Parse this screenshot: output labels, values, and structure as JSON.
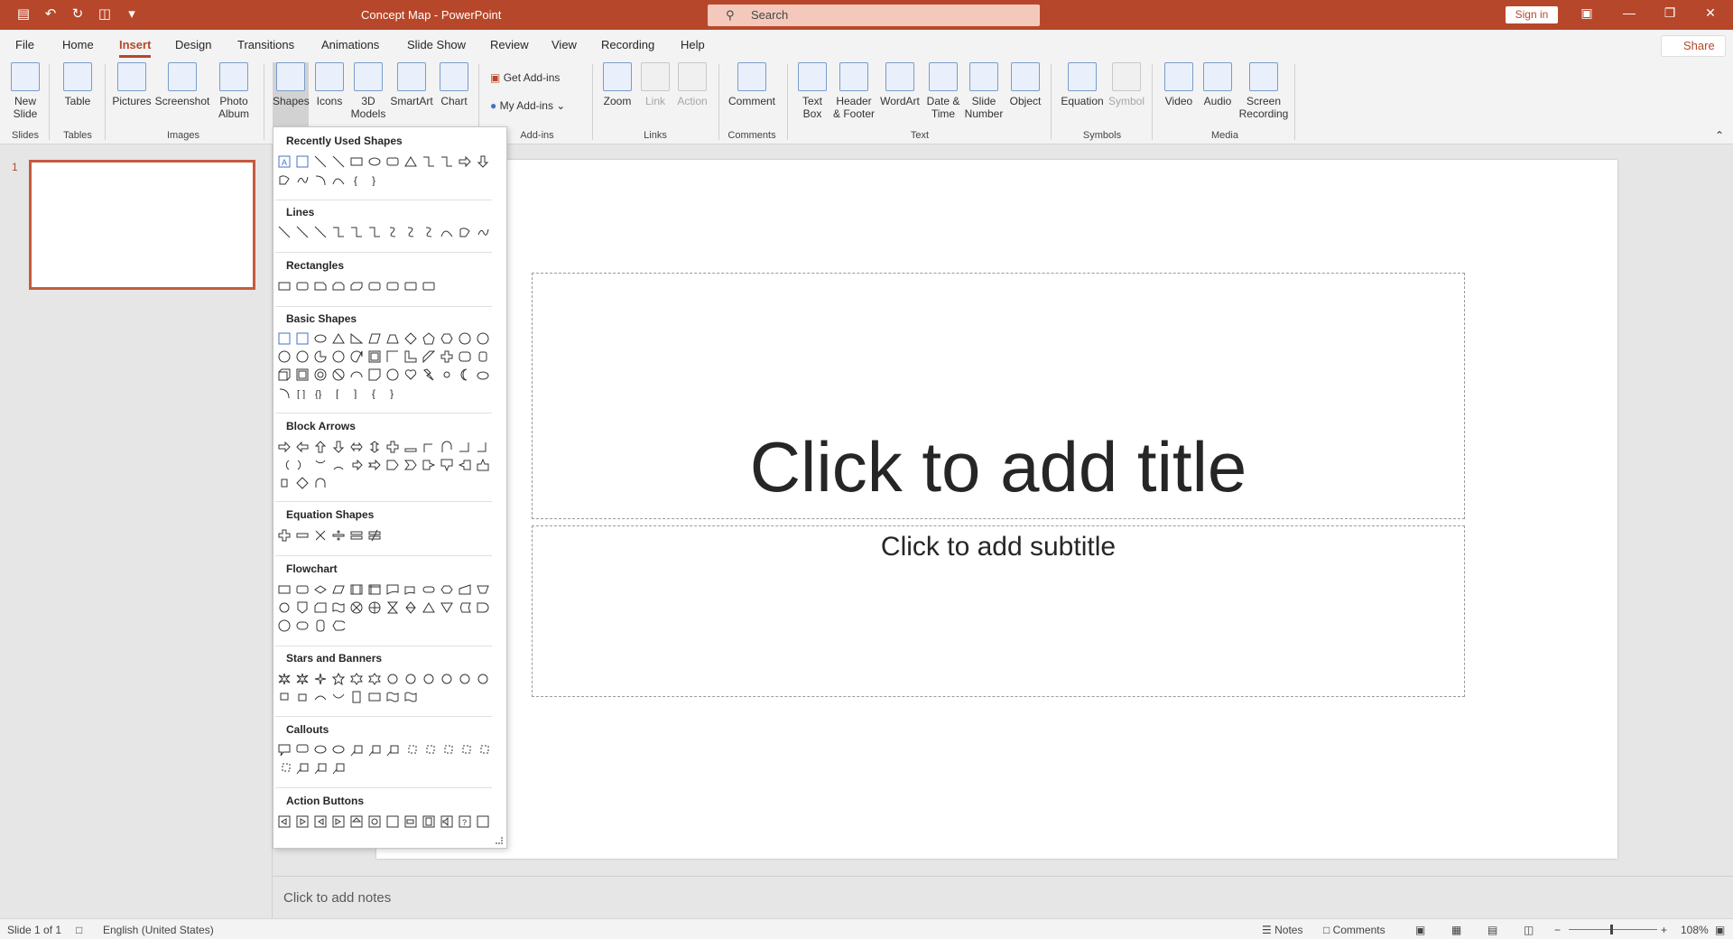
{
  "titlebar": {
    "doc_title": "Concept Map  -  PowerPoint",
    "search_placeholder": "Search",
    "signin_label": "Sign in"
  },
  "tabs": [
    "File",
    "Home",
    "Insert",
    "Design",
    "Transitions",
    "Animations",
    "Slide Show",
    "Review",
    "View",
    "Recording",
    "Help"
  ],
  "share_label": "Share",
  "ribbon": {
    "new_slide": "New\nSlide",
    "table": "Table",
    "pictures": "Pictures",
    "screenshot": "Screenshot",
    "photo_album": "Photo\nAlbum",
    "shapes": "Shapes",
    "icons": "Icons",
    "models": "3D\nModels",
    "smartart": "SmartArt",
    "chart": "Chart",
    "get_addins": "Get Add-ins",
    "my_addins": "My Add-ins",
    "zoom": "Zoom",
    "link": "Link",
    "action": "Action",
    "comment": "Comment",
    "text_box": "Text\nBox",
    "header_footer": "Header\n& Footer",
    "wordart": "WordArt",
    "date_time": "Date &\nTime",
    "slide_number": "Slide\nNumber",
    "object": "Object",
    "equation": "Equation",
    "symbol": "Symbol",
    "video": "Video",
    "audio": "Audio",
    "screen_recording": "Screen\nRecording",
    "groups": {
      "slides": "Slides",
      "tables": "Tables",
      "images": "Images",
      "addins": "Add-ins",
      "links": "Links",
      "comments": "Comments",
      "text": "Text",
      "symbols": "Symbols",
      "media": "Media"
    }
  },
  "thumbnail_number": "1",
  "slide": {
    "title_placeholder": "Click to add title",
    "subtitle_placeholder": "Click to add subtitle"
  },
  "notes_placeholder": "Click to add notes",
  "shapes_panel": {
    "sections": [
      "Recently Used Shapes",
      "Lines",
      "Rectangles",
      "Basic Shapes",
      "Block Arrows",
      "Equation Shapes",
      "Flowchart",
      "Stars and Banners",
      "Callouts",
      "Action Buttons"
    ]
  },
  "status": {
    "slide_count": "Slide 1 of 1",
    "language": "English (United States)",
    "notes": "Notes",
    "comments": "Comments",
    "zoom": "108%"
  }
}
